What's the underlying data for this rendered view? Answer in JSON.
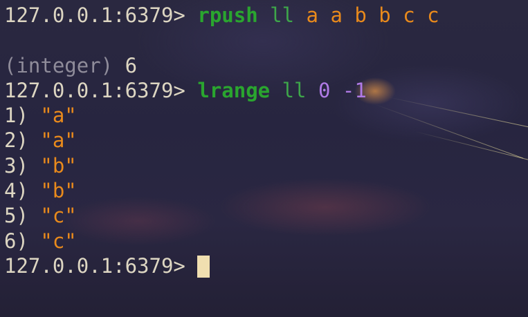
{
  "terminal": {
    "prompt": "127.0.0.1:6379> ",
    "commands": [
      {
        "name": "rpush",
        "key": "ll",
        "args": "a a b b c c"
      },
      {
        "name": "lrange",
        "key": "ll",
        "start": "0",
        "end": "-1"
      }
    ],
    "reply_type": "(integer)",
    "reply_value": "6",
    "list_results": [
      {
        "index": "1)",
        "value": "\"a\""
      },
      {
        "index": "2)",
        "value": "\"a\""
      },
      {
        "index": "3)",
        "value": "\"b\""
      },
      {
        "index": "4)",
        "value": "\"b\""
      },
      {
        "index": "5)",
        "value": "\"c\""
      },
      {
        "index": "6)",
        "value": "\"c\""
      }
    ]
  },
  "colors": {
    "prompt": "#ddd6c2",
    "command": "#2aa52f",
    "argument": "#e98a1c",
    "number": "#b07ae6",
    "cursor": "#f0dfb0"
  }
}
